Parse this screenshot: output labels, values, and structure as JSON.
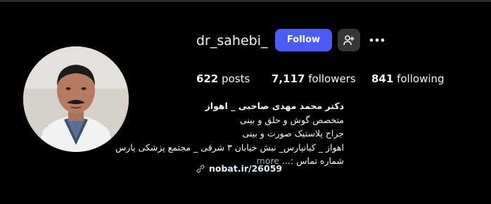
{
  "profile": {
    "username": "dr_sahebi_",
    "follow_label": "Follow",
    "more_label": "•••"
  },
  "stats": {
    "posts_count": "622",
    "posts_label": "posts",
    "followers_count": "7,117",
    "followers_label": "followers",
    "following_count": "841",
    "following_label": "following"
  },
  "bio": {
    "name": "دکتر محمد مهدی صاحبی _ اهواز",
    "line1": "متخصص گوش و حلق و بینی",
    "line2": "جراح پلاستیک صورت و بینی",
    "line3": "اهواز _ کیانپارس_ نبش خیابان ۳ شرقی _ مجتمع پزشکی پارس",
    "line4": "شماره تماس :...",
    "more_label": "more"
  },
  "link": {
    "text": "nobat.ir/26059"
  },
  "icons": {
    "add_user": "person-add-icon",
    "link": "link-icon",
    "more": "more-options-icon"
  },
  "colors": {
    "background": "#000000",
    "accent": "#4a5df9",
    "secondary_button": "#363636",
    "link": "#e0f1ff"
  }
}
